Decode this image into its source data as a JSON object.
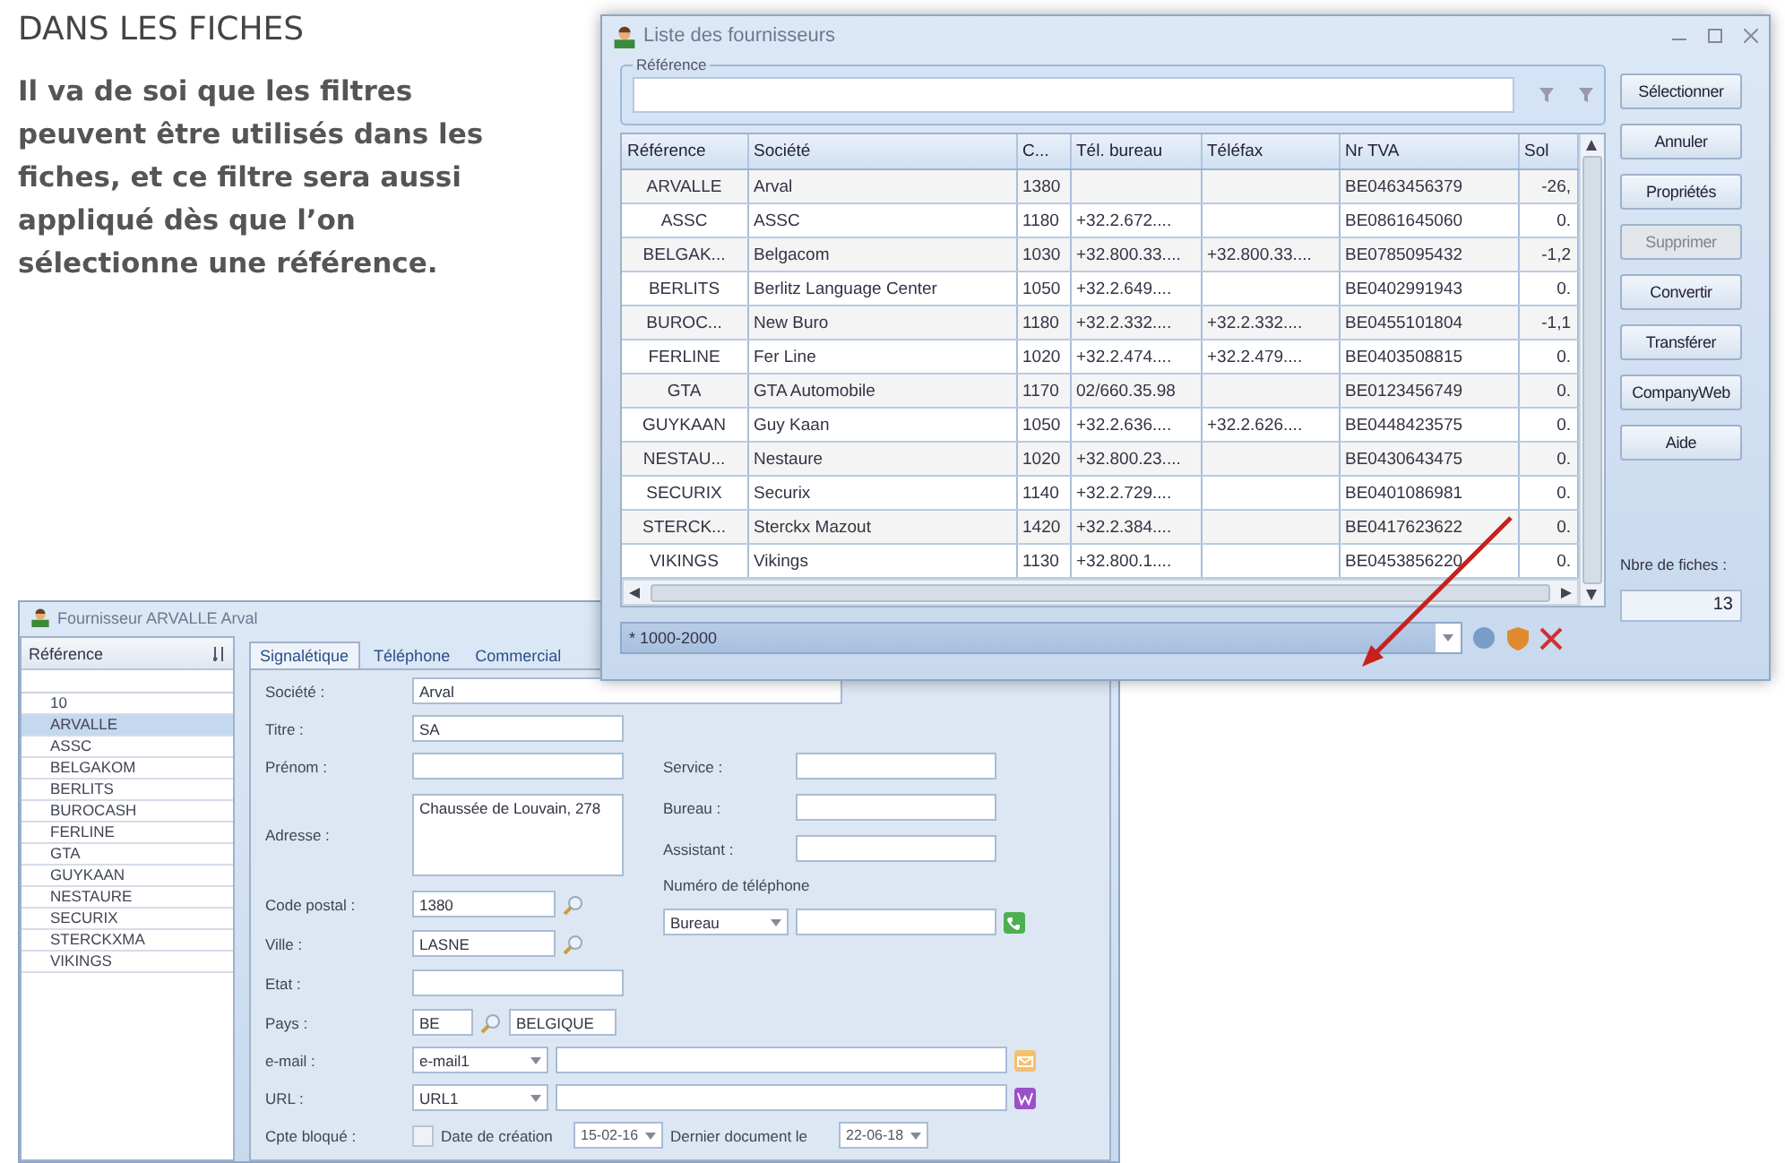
{
  "heading": "DANS LES FICHES",
  "paragraph": "Il va de soi que les filtres peuvent être utilisés dans les fiches, et ce filtre sera aussi appliqué dès que l’on sélectionne une référence.",
  "supplier_window": {
    "title": "Fournisseur ARVALLE Arval",
    "reference_list": {
      "header": "Référence",
      "items": [
        {
          "label": "10",
          "selected": false
        },
        {
          "label": "ARVALLE",
          "selected": true
        },
        {
          "label": "ASSC",
          "selected": false
        },
        {
          "label": "BELGAKOM",
          "selected": false
        },
        {
          "label": "BERLITS",
          "selected": false
        },
        {
          "label": "BUROCASH",
          "selected": false
        },
        {
          "label": "FERLINE",
          "selected": false
        },
        {
          "label": "GTA",
          "selected": false
        },
        {
          "label": "GUYKAAN",
          "selected": false
        },
        {
          "label": "NESTAURE",
          "selected": false
        },
        {
          "label": "SECURIX",
          "selected": false
        },
        {
          "label": "STERCKXMA",
          "selected": false
        },
        {
          "label": "VIKINGS",
          "selected": false
        }
      ]
    },
    "tabs": [
      {
        "label": "Signalétique",
        "selected": true
      },
      {
        "label": "Téléphone",
        "selected": false
      },
      {
        "label": "Commercial",
        "selected": false
      }
    ],
    "form": {
      "company": {
        "label": "Société :",
        "value": "Arval"
      },
      "title": {
        "label": "Titre :",
        "value": "SA"
      },
      "first_name": {
        "label": "Prénom :"
      },
      "address": {
        "label": "Adresse :",
        "value": "Chaussée de Louvain, 278"
      },
      "postal_code": {
        "label": "Code postal :",
        "value": "1380"
      },
      "city": {
        "label": "Ville :",
        "value": "LASNE"
      },
      "state": {
        "label": "Etat :"
      },
      "country": {
        "label": "Pays :",
        "code": "BE",
        "name": "BELGIQUE"
      },
      "service": {
        "label": "Service :"
      },
      "office": {
        "label": "Bureau :"
      },
      "assistant": {
        "label": "Assistant :"
      },
      "phone": {
        "label": "Numéro de téléphone",
        "type": "Bureau"
      },
      "email": {
        "label": "e-mail :",
        "type": "e-mail1"
      },
      "url": {
        "label": "URL :",
        "type": "URL1"
      },
      "blocked": {
        "label": "Cpte bloqué :",
        "checked": false
      },
      "created": {
        "label": "Date de création",
        "value": "15-02-16"
      },
      "last_document": {
        "label": "Dernier document le",
        "value": "22-06-18"
      }
    }
  },
  "list_window": {
    "title": "Liste des fournisseurs",
    "filter_group": {
      "legend": "Référence"
    },
    "table": {
      "columns": [
        "Référence",
        "Société",
        "C...",
        "Tél. bureau",
        "Téléfax",
        "Nr TVA",
        "Sol"
      ],
      "rows": [
        [
          "ARVALLE",
          "Arval",
          "1380",
          "",
          "",
          "BE0463456379",
          "-26,"
        ],
        [
          "ASSC",
          "ASSC",
          "1180",
          "+32.2.672....",
          "",
          "BE0861645060",
          "0."
        ],
        [
          "BELGAK...",
          "Belgacom",
          "1030",
          "+32.800.33....",
          "+32.800.33....",
          "BE0785095432",
          "-1,2"
        ],
        [
          "BERLITS",
          "Berlitz Language Center",
          "1050",
          "+32.2.649....",
          "",
          "BE0402991943",
          "0."
        ],
        [
          "BUROC...",
          "New Buro",
          "1180",
          "+32.2.332....",
          "+32.2.332....",
          "BE0455101804",
          "-1,1"
        ],
        [
          "FERLINE",
          "Fer Line",
          "1020",
          "+32.2.474....",
          "+32.2.479....",
          "BE0403508815",
          "0."
        ],
        [
          "GTA",
          "GTA Automobile",
          "1170",
          "02/660.35.98",
          "",
          "BE0123456749",
          "0."
        ],
        [
          "GUYKAAN",
          "Guy Kaan",
          "1050",
          "+32.2.636....",
          "+32.2.626....",
          "BE0448423575",
          "0."
        ],
        [
          "NESTAU...",
          "Nestaure",
          "1020",
          "+32.800.23....",
          "",
          "BE0430643475",
          "0."
        ],
        [
          "SECURIX",
          "Securix",
          "1140",
          "+32.2.729....",
          "",
          "BE0401086981",
          "0."
        ],
        [
          "STERCK...",
          "Sterckx Mazout",
          "1420",
          "+32.2.384....",
          "",
          "BE0417623622",
          "0."
        ],
        [
          "VIKINGS",
          "Vikings",
          "1130",
          "+32.800.1....",
          "",
          "BE0453856220",
          "0."
        ]
      ]
    },
    "buttons": [
      {
        "label": "Sélectionner",
        "disabled": false
      },
      {
        "label": "Annuler",
        "disabled": false
      },
      {
        "label": "Propriétés",
        "disabled": false
      },
      {
        "label": "Supprimer",
        "disabled": true
      },
      {
        "label": "Convertir",
        "disabled": false
      },
      {
        "label": "Transférer",
        "disabled": false
      },
      {
        "label": "CompanyWeb",
        "disabled": false
      },
      {
        "label": "Aide",
        "disabled": false
      }
    ],
    "count": {
      "label": "Nbre de fiches :",
      "value": "13"
    },
    "filter_bar": {
      "value": "* 1000-2000"
    }
  }
}
